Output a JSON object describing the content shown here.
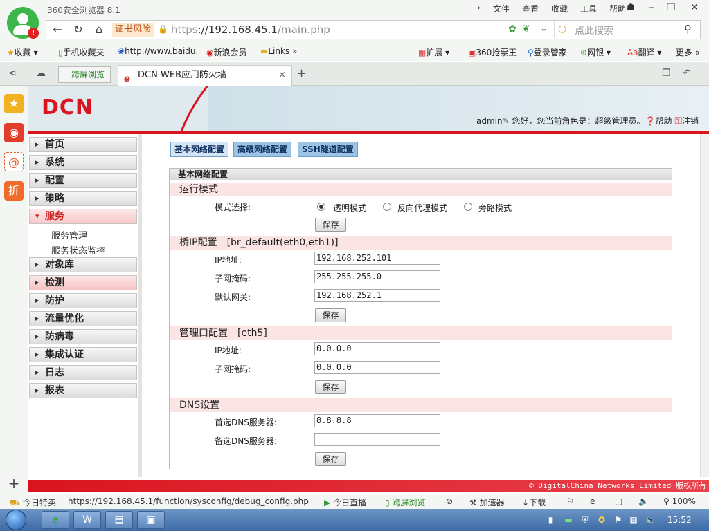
{
  "browser": {
    "app_name": "360安全浏览器 8.1",
    "menu": [
      "文件",
      "查看",
      "收藏",
      "工具",
      "帮助"
    ],
    "cert_warning": "证书风险",
    "url_proto": "https",
    "url_host": "://192.168.45.1",
    "url_path": "/main.php",
    "search_placeholder": "点此搜索",
    "bookmarks": [
      "收藏",
      "手机收藏夹",
      "http://www.baidu.",
      "新浪会员",
      "Links",
      "扩展",
      "360抢票王",
      "登录管家",
      "网银",
      "翻译",
      "更多"
    ],
    "tab_split": "跨屏浏览",
    "tab_active": "DCN-WEB应用防火墙"
  },
  "app": {
    "logo": "DCN",
    "user": "admin",
    "greeting": "您好，您当前角色是：超级管理员。",
    "help": "帮助",
    "logout": "注销",
    "footer": "© DigitalChina Networks Limited 版权所有"
  },
  "menu": {
    "items": [
      "首页",
      "系统",
      "配置",
      "策略",
      "服务",
      "对象库",
      "检测",
      "防护",
      "流量优化",
      "防病毒",
      "集成认证",
      "日志",
      "报表"
    ],
    "sub": [
      "服务管理",
      "服务状态监控"
    ]
  },
  "tabs": [
    "基本网络配置",
    "高级网络配置",
    "SSH隧道配置"
  ],
  "form": {
    "title": "基本网络配置",
    "save": "保存",
    "run_mode": {
      "title": "运行模式",
      "label": "模式选择:",
      "options": [
        "透明模式",
        "反向代理模式",
        "旁路模式"
      ],
      "selected": "透明模式"
    },
    "bridge": {
      "title": "桥IP配置　[br_default(eth0,eth1)]",
      "ip_label": "IP地址:",
      "ip": "192.168.252.101",
      "mask_label": "子网掩码:",
      "mask": "255.255.255.0",
      "gw_label": "默认网关:",
      "gw": "192.168.252.1"
    },
    "mgmt": {
      "title": "管理口配置　[eth5]",
      "ip_label": "IP地址:",
      "ip": "0.0.0.0",
      "mask_label": "子网掩码:",
      "mask": "0.0.0.0"
    },
    "dns": {
      "title": "DNS设置",
      "primary_label": "首选DNS服务器:",
      "primary": "8.8.8.8",
      "secondary_label": "备选DNS服务器:",
      "secondary": ""
    }
  },
  "status": {
    "left": "今日特卖",
    "url": "https://192.168.45.1/function/sysconfig/debug_config.php",
    "live": "今日直播",
    "split": "跨屏浏览",
    "speed": "加速器",
    "download": "下载",
    "zoom": "100%"
  },
  "taskbar": {
    "clock": "15:52"
  }
}
